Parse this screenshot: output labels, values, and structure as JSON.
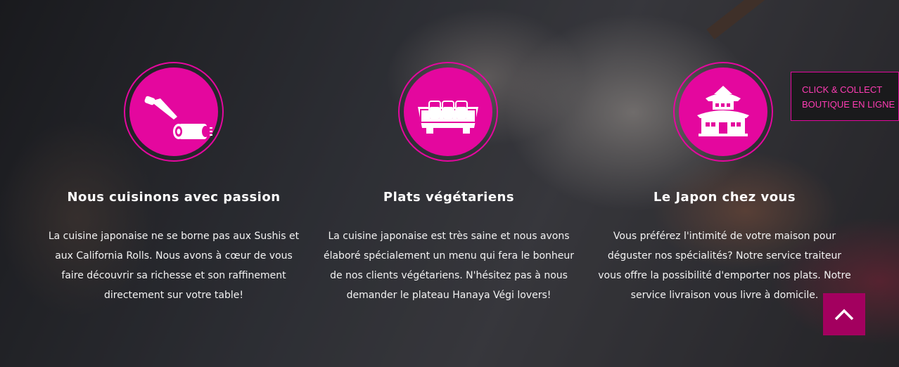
{
  "theme": {
    "accent": "#e4079e",
    "button_accent": "#a3005f"
  },
  "features": [
    {
      "icon": "sushi-roll-knife-icon",
      "title": "Nous cuisinons avec passion",
      "text_lines": [
        "La cuisine japonaise ne se borne pas aux Sushis et",
        "aux California Rolls. Nous avons à cœur de vous",
        "faire découvrir sa richesse et son raffinement",
        "directement sur votre table!"
      ]
    },
    {
      "icon": "sushi-tray-icon",
      "title": "Plats végétariens",
      "text_lines": [
        "La cuisine japonaise est très saine et nous avons",
        "élaboré spécialement un menu qui fera le bonheur",
        "de nos clients végétariens. N'hésitez pas à nous",
        "demander le plateau Hanaya Végi lovers!"
      ]
    },
    {
      "icon": "pagoda-house-icon",
      "title": "Le Japon chez vous",
      "text_lines": [
        "Vous préférez l'intimité de votre maison pour",
        "déguster nos spécialités? Notre service traiteur",
        "vous offre la possibilité d'emporter nos plats. Notre",
        "service livraison vous livre à domicile."
      ]
    }
  ],
  "click_collect": {
    "line1": "CLICK & COLLECT",
    "line2": "BOUTIQUE EN LIGNE"
  },
  "scroll_top": {
    "icon": "chevron-up-icon"
  }
}
